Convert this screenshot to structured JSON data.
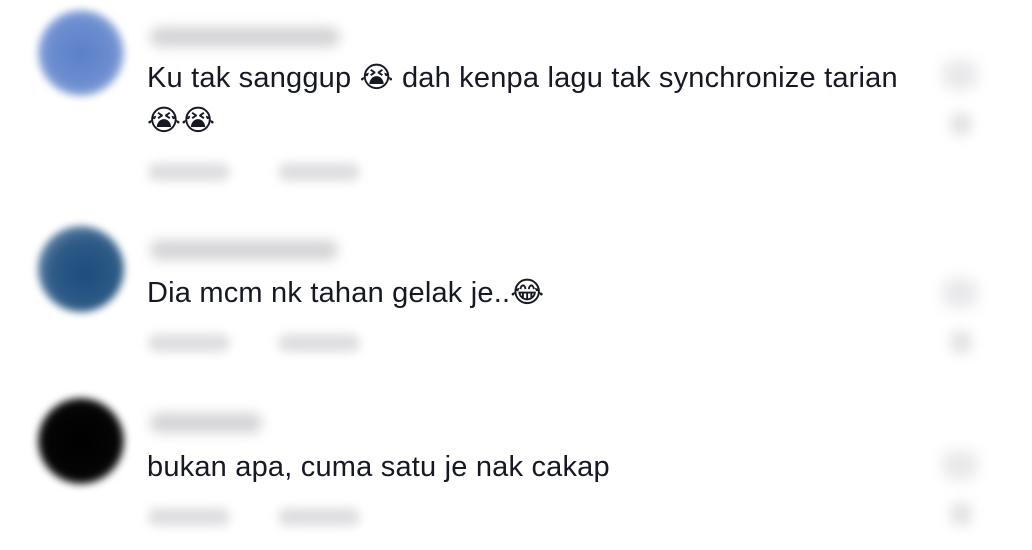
{
  "comments": [
    {
      "text": "Ku tak sanggup 😭 dah kenpa lagu tak synchronize tarian 😭😭",
      "avatar_color": "#5b7fc8"
    },
    {
      "text": "Dia mcm nk tahan gelak je..😂",
      "avatar_color": "#2e5a86"
    },
    {
      "text": "bukan apa, cuma satu je nak cakap",
      "avatar_color": "#050505"
    }
  ]
}
